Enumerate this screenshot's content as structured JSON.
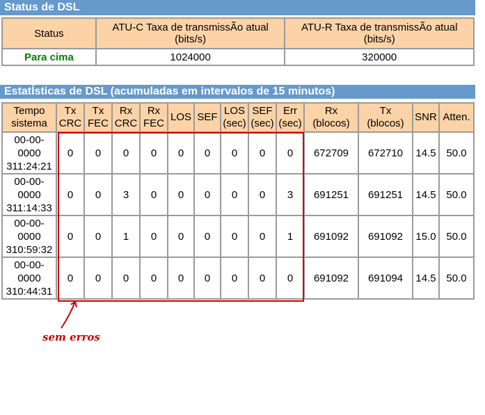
{
  "status_section": {
    "title": "Status de DSL",
    "headers": [
      "Status",
      "ATU-C Taxa de transmissÃo atual (bits/s)",
      "ATU-R Taxa de transmissÃo atual (bits/s)"
    ],
    "row": {
      "status": "Para cima",
      "atu_c": "1024000",
      "atu_r": "320000"
    }
  },
  "stats_section": {
    "title": "EstatÍsticas de DSL (acumuladas em intervalos de 15 minutos)",
    "headers": {
      "time": [
        "Tempo",
        "sistema"
      ],
      "tx_crc": [
        "Tx",
        "CRC"
      ],
      "tx_fec": [
        "Tx",
        "FEC"
      ],
      "rx_crc": [
        "Rx",
        "CRC"
      ],
      "rx_fec": [
        "Rx",
        "FEC"
      ],
      "los": "LOS",
      "sef": "SEF",
      "los_sec": [
        "LOS",
        "(sec)"
      ],
      "sef_sec": [
        "SEF",
        "(sec)"
      ],
      "err_sec": [
        "Err",
        "(sec)"
      ],
      "rx_blocks": [
        "Rx",
        "(blocos)"
      ],
      "tx_blocks": [
        "Tx",
        "(blocos)"
      ],
      "snr": "SNR",
      "atten": "Atten."
    },
    "rows": [
      {
        "date": "00-00-0000",
        "time": "311:24:21",
        "tx_crc": "0",
        "tx_fec": "0",
        "rx_crc": "0",
        "rx_fec": "0",
        "los": "0",
        "sef": "0",
        "los_sec": "0",
        "sef_sec": "0",
        "err_sec": "0",
        "rx_blocks": "672709",
        "tx_blocks": "672710",
        "snr": "14.5",
        "atten": "50.0"
      },
      {
        "date": "00-00-0000",
        "time": "311:14:33",
        "tx_crc": "0",
        "tx_fec": "0",
        "rx_crc": "3",
        "rx_fec": "0",
        "los": "0",
        "sef": "0",
        "los_sec": "0",
        "sef_sec": "0",
        "err_sec": "3",
        "rx_blocks": "691251",
        "tx_blocks": "691251",
        "snr": "14.5",
        "atten": "50.0"
      },
      {
        "date": "00-00-0000",
        "time": "310:59:32",
        "tx_crc": "0",
        "tx_fec": "0",
        "rx_crc": "1",
        "rx_fec": "0",
        "los": "0",
        "sef": "0",
        "los_sec": "0",
        "sef_sec": "0",
        "err_sec": "1",
        "rx_blocks": "691092",
        "tx_blocks": "691092",
        "snr": "15.0",
        "atten": "50.0"
      },
      {
        "date": "00-00-0000",
        "time": "310:44:31",
        "tx_crc": "0",
        "tx_fec": "0",
        "rx_crc": "0",
        "rx_fec": "0",
        "los": "0",
        "sef": "0",
        "los_sec": "0",
        "sef_sec": "0",
        "err_sec": "0",
        "rx_blocks": "691092",
        "tx_blocks": "691094",
        "snr": "14.5",
        "atten": "50.0"
      }
    ]
  },
  "annotation": {
    "text": "sem erros",
    "color": "#cc0000"
  },
  "colors": {
    "section_bar": "#6699cc",
    "header_bg": "#fbd3a7",
    "status_up": "#008000"
  }
}
